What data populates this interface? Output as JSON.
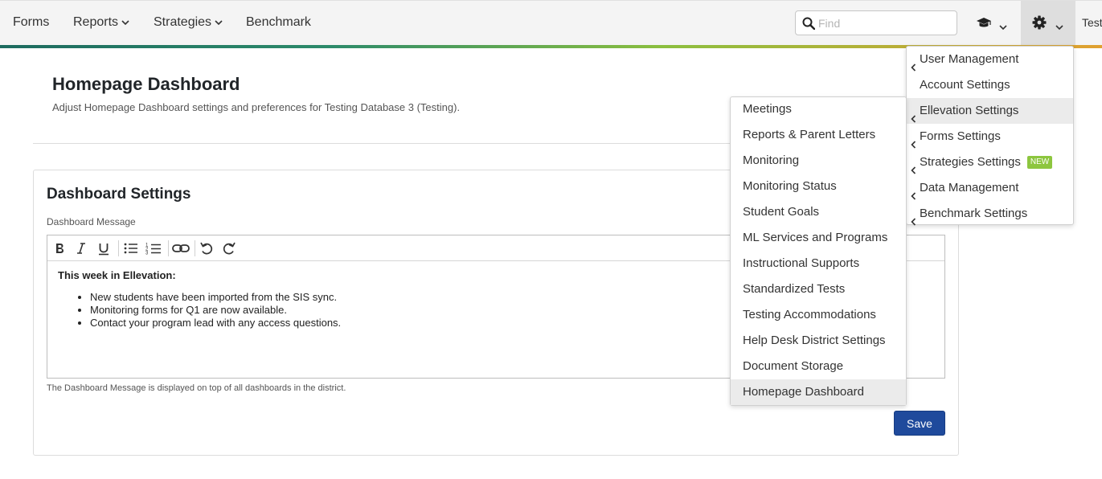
{
  "navbar": {
    "items": [
      {
        "label": "Forms",
        "has_caret": false
      },
      {
        "label": "Reports",
        "has_caret": true
      },
      {
        "label": "Strategies",
        "has_caret": true
      },
      {
        "label": "Benchmark",
        "has_caret": false
      }
    ],
    "search_placeholder": "Find",
    "search_icon": "search-icon",
    "education_icon": "graduation-cap-icon",
    "settings_icon": "gear-icon",
    "truncated_label": "Test",
    "accent_colors": [
      "#1d6b5f",
      "#8bbf3f",
      "#e0a030"
    ]
  },
  "page": {
    "title": "Homepage Dashboard",
    "subtitle": "Adjust Homepage Dashboard settings and preferences for Testing Database 3 (Testing)."
  },
  "card": {
    "title": "Dashboard Settings",
    "field_label": "Dashboard Message",
    "toolbar": [
      "bold-icon",
      "italic-icon",
      "underline-icon",
      "bulleted-list-icon",
      "numbered-list-icon",
      "link-icon",
      "undo-icon",
      "redo-icon"
    ],
    "editor": {
      "heading": "This week in Ellevation:",
      "bullets": [
        "New students have been imported from the SIS sync.",
        "Monitoring forms for Q1 are now available.",
        "Contact your program lead with any access questions."
      ]
    },
    "help_text": "The Dashboard Message is displayed on top of all dashboards in the district.",
    "save_label": "Save",
    "save_color": "#1f4a9c"
  },
  "settings_menu": {
    "items": [
      {
        "label": "User Management",
        "has_submenu": true
      },
      {
        "label": "Account Settings",
        "has_submenu": false
      },
      {
        "label": "Ellevation Settings",
        "has_submenu": true,
        "active": true
      },
      {
        "label": "Forms Settings",
        "has_submenu": true
      },
      {
        "label": "Strategies Settings",
        "has_submenu": true,
        "badge": "NEW"
      },
      {
        "label": "Data Management",
        "has_submenu": true
      },
      {
        "label": "Benchmark Settings",
        "has_submenu": true
      }
    ],
    "badge_color": "#8dc63f"
  },
  "ellevation_submenu": {
    "items": [
      {
        "label": "Meetings"
      },
      {
        "label": "Reports & Parent Letters"
      },
      {
        "label": "Monitoring"
      },
      {
        "label": "Monitoring Status"
      },
      {
        "label": "Student Goals"
      },
      {
        "label": "ML Services and Programs"
      },
      {
        "label": "Instructional Supports"
      },
      {
        "label": "Standardized Tests"
      },
      {
        "label": "Testing Accommodations"
      },
      {
        "label": "Help Desk District Settings"
      },
      {
        "label": "Document Storage"
      },
      {
        "label": "Homepage Dashboard",
        "active": true
      }
    ]
  }
}
